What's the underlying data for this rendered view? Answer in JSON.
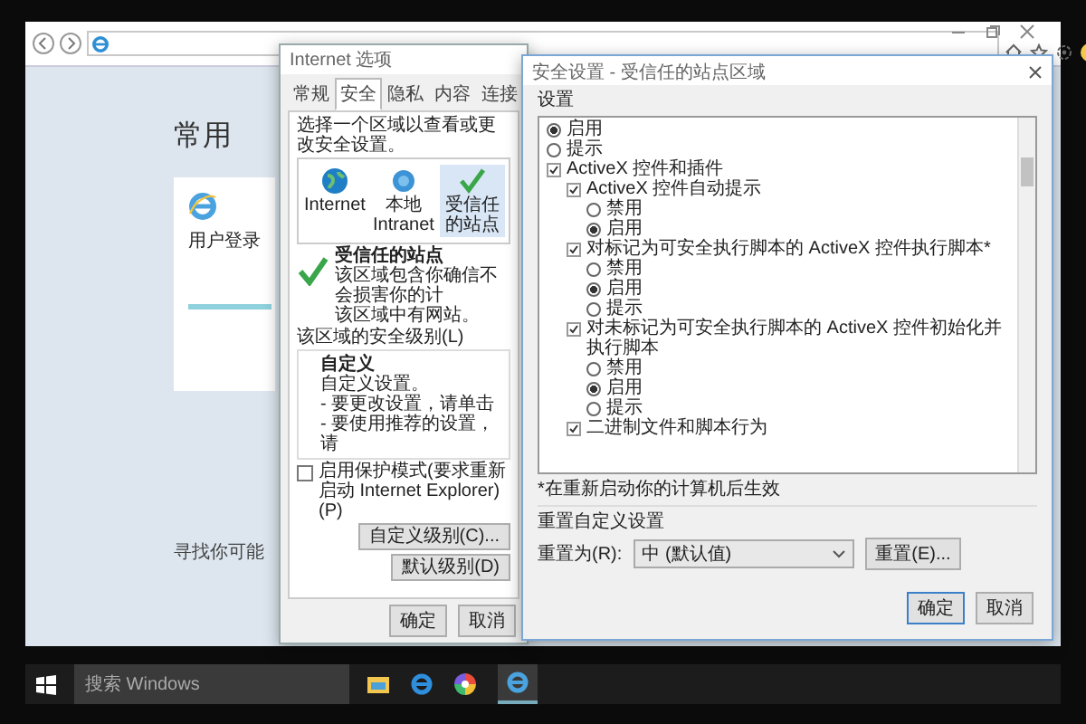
{
  "browser": {
    "page": {
      "heading": "常用",
      "tile": {
        "label": "用户登录"
      },
      "footer_text": "寻找你可能"
    }
  },
  "internet_options": {
    "title": "Internet 选项",
    "tabs": [
      {
        "label": "常规",
        "selected": false
      },
      {
        "label": "安全",
        "selected": true
      },
      {
        "label": "隐私",
        "selected": false
      },
      {
        "label": "内容",
        "selected": false
      },
      {
        "label": "连接",
        "selected": false
      }
    ],
    "prompt": "选择一个区域以查看或更改安全设置。",
    "zones": [
      {
        "kind": "globe",
        "label": "Internet",
        "selected": false
      },
      {
        "kind": "network",
        "label": "本地 Intranet",
        "selected": false
      },
      {
        "kind": "check",
        "label": "受信任的站点",
        "selected": true
      }
    ],
    "zone_heading": "受信任的站点",
    "zone_description": "该区域包含你确信不会损害你的计",
    "zone_sites": "该区域中有网站。",
    "level_label": "该区域的安全级别(L)",
    "level_name": "自定义",
    "level_lines": [
      "自定义设置。",
      "- 要更改设置，请单击",
      "- 要使用推荐的设置，请"
    ],
    "protected_mode": {
      "label": "启用保护模式(要求重新启动 Internet Explorer)(P)",
      "checked": false
    },
    "level_buttons": [
      "自定义级别(C)...",
      "默认级别(D)"
    ],
    "buttons": [
      "确定",
      "取消"
    ]
  },
  "security_settings": {
    "title": "安全设置 - 受信任的站点区域",
    "settings_label": "设置",
    "settings": [
      {
        "kind": "radio",
        "label": "启用",
        "selected": true
      },
      {
        "kind": "radio",
        "label": "提示",
        "selected": false
      },
      {
        "kind": "group",
        "label": "ActiveX 控件和插件",
        "children": [
          {
            "kind": "group",
            "label": "ActiveX 控件自动提示",
            "children": [
              {
                "kind": "radio",
                "label": "禁用",
                "selected": false
              },
              {
                "kind": "radio",
                "label": "启用",
                "selected": true
              }
            ]
          },
          {
            "kind": "group",
            "label": "对标记为可安全执行脚本的 ActiveX 控件执行脚本*",
            "children": [
              {
                "kind": "radio",
                "label": "禁用",
                "selected": false
              },
              {
                "kind": "radio",
                "label": "启用",
                "selected": true
              },
              {
                "kind": "radio",
                "label": "提示",
                "selected": false
              }
            ]
          },
          {
            "kind": "group",
            "label": "对未标记为可安全执行脚本的 ActiveX 控件初始化并执行脚本",
            "children": [
              {
                "kind": "radio",
                "label": "禁用",
                "selected": false
              },
              {
                "kind": "radio",
                "label": "启用",
                "selected": true
              },
              {
                "kind": "radio",
                "label": "提示",
                "selected": false
              }
            ]
          },
          {
            "kind": "group",
            "label": "二进制文件和脚本行为"
          }
        ]
      }
    ],
    "note": "*在重新启动你的计算机后生效",
    "reset_group": "重置自定义设置",
    "reset_label": "重置为(R):",
    "reset_value": "中 (默认值)",
    "reset_button": "重置(E)...",
    "buttons": [
      "确定",
      "取消"
    ]
  },
  "taskbar": {
    "search": {
      "placeholder": "搜索 Windows"
    }
  }
}
